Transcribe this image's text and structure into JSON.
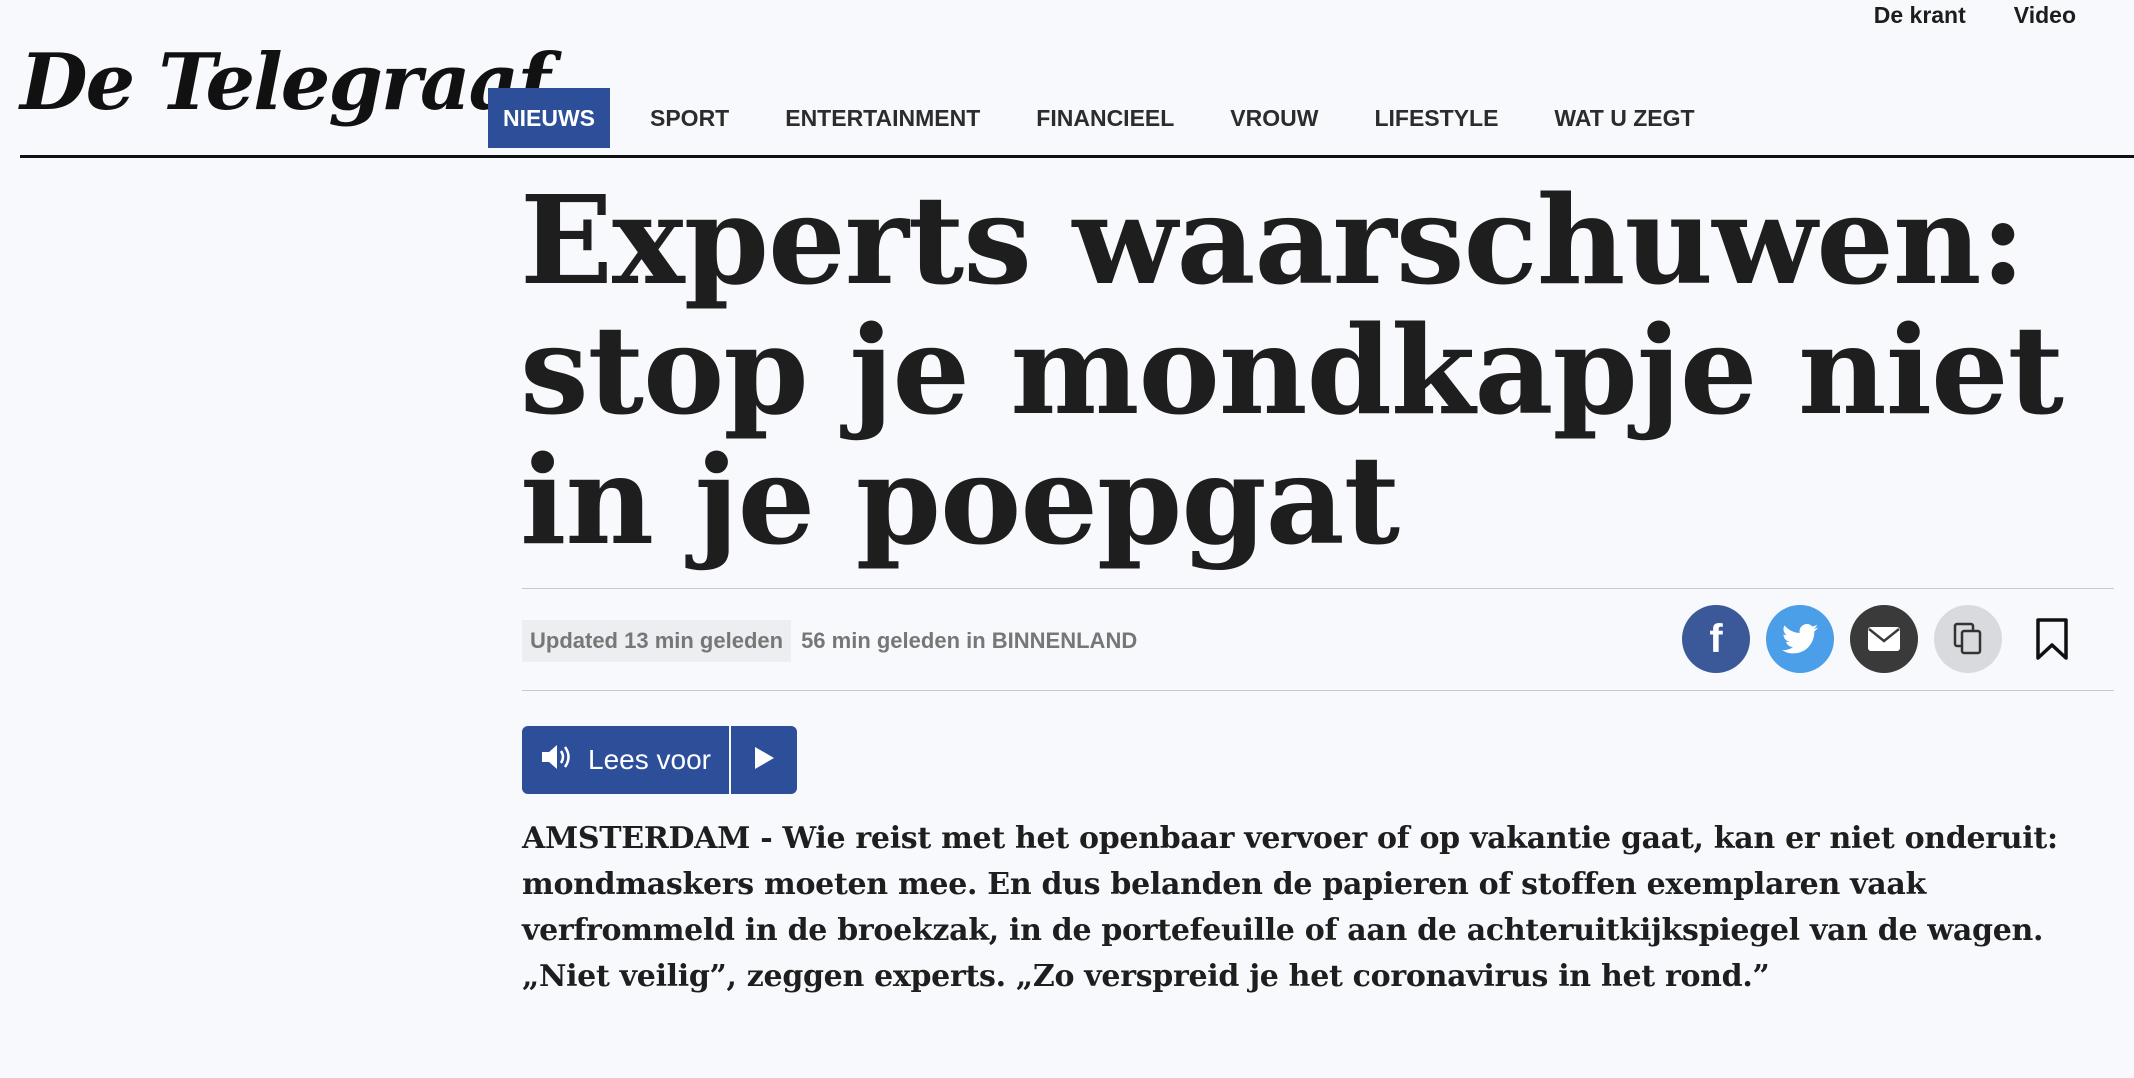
{
  "util_links": [
    "De krant",
    "Video"
  ],
  "logo": "De Telegraaf",
  "nav": {
    "items": [
      {
        "label": "NIEUWS",
        "active": true
      },
      {
        "label": "SPORT"
      },
      {
        "label": "ENTERTAINMENT"
      },
      {
        "label": "FINANCIEEL"
      },
      {
        "label": "VROUW"
      },
      {
        "label": "LIFESTYLE"
      },
      {
        "label": "WAT U ZEGT"
      }
    ]
  },
  "article": {
    "headline": "Experts waarschuwen: stop je mondkapje niet in je poepgat",
    "updated": "Updated 13 min geleden",
    "published": "56 min geleden in BINNENLAND",
    "lees_voor": "Lees voor",
    "lead": "AMSTERDAM - Wie reist met het openbaar vervoer of op vakantie gaat, kan er niet onderuit: mondmaskers moeten mee. En dus belanden de papieren of stoffen exemplaren vaak verfrommeld in de broekzak, in de portefeuille of aan de achteruitkijkspiegel van de wagen. „Niet veilig”, zeggen experts. „Zo verspreid je het coronavirus in het rond.”"
  },
  "share_icons": [
    "facebook-icon",
    "twitter-icon",
    "mail-icon",
    "copy-icon",
    "bookmark-icon"
  ],
  "colors": {
    "accent": "#2d4f9a",
    "facebook": "#3b5998",
    "twitter": "#4a9fe8",
    "mail": "#3a3a3a",
    "copy": "#d9dadd"
  }
}
